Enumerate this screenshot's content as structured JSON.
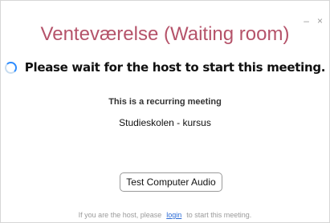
{
  "window": {
    "title": "Venteværelse (Waiting room)",
    "minimize_glyph": "–",
    "close_glyph": "×"
  },
  "status": {
    "message": "Please wait for the host to start this meeting.",
    "spinner_icon": "loading-spinner-icon"
  },
  "meeting": {
    "recurring_label": "This is a recurring meeting",
    "name": "Studieskolen - kursus"
  },
  "actions": {
    "test_audio_label": "Test Computer Audio"
  },
  "host_prompt": {
    "prefix": "If you are the host, please",
    "login_label": "login",
    "suffix": "to start this meeting."
  },
  "colors": {
    "title": "#b5536a",
    "link": "#2d6cd6",
    "spinner": "#2d8cff"
  }
}
